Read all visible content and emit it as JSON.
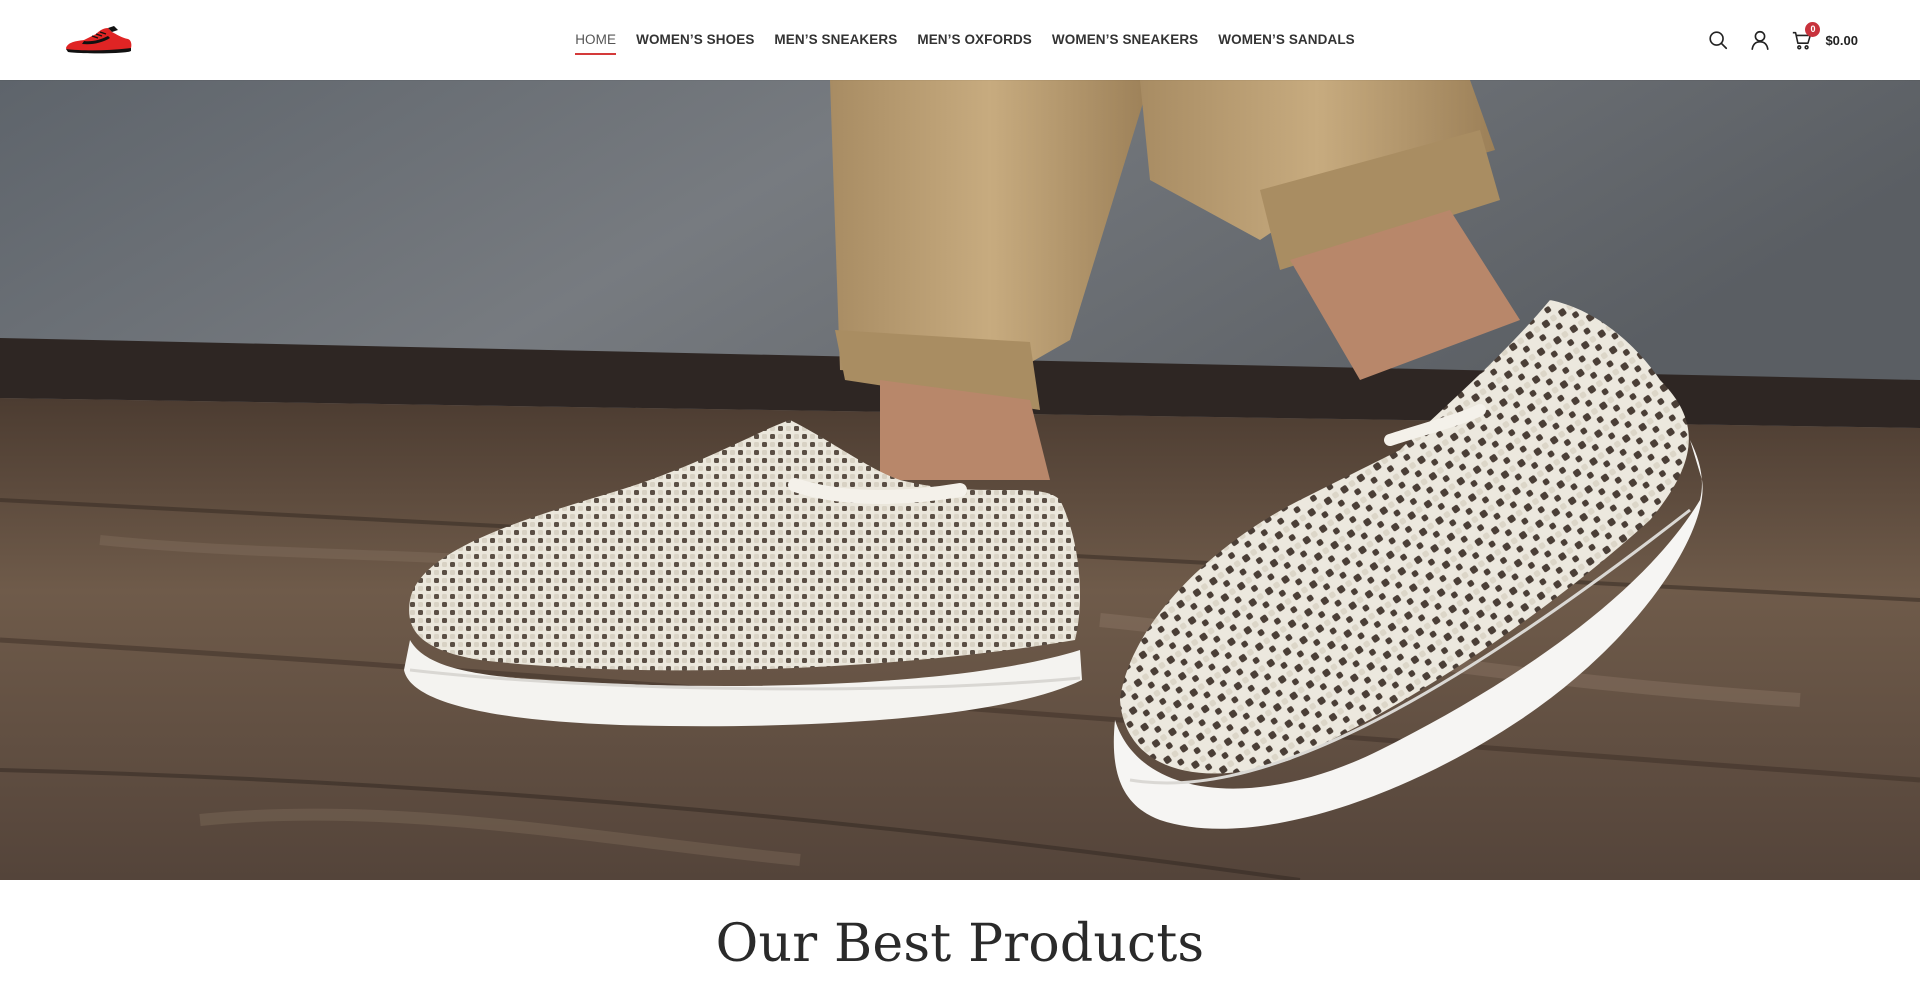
{
  "brand": {
    "logo_icon": "red-sneaker-logo",
    "accent_color": "#d42a2a"
  },
  "nav": {
    "items": [
      {
        "label": "HOME",
        "active": true
      },
      {
        "label": "WOMEN’S SHOES",
        "active": false
      },
      {
        "label": "MEN’S SNEAKERS",
        "active": false
      },
      {
        "label": "MEN’S OXFORDS",
        "active": false
      },
      {
        "label": "WOMEN’S SNEAKERS",
        "active": false
      },
      {
        "label": "WOMEN’S SANDALS",
        "active": false
      }
    ]
  },
  "header_actions": {
    "search_icon": "search-icon",
    "account_icon": "user-icon",
    "cart_icon": "cart-icon",
    "cart_count": "0",
    "cart_total": "$0.00",
    "badge_color": "#c8323c"
  },
  "hero": {
    "image": "woven-slip-on-shoes-photo"
  },
  "products_section": {
    "title": "Our Best Products"
  }
}
